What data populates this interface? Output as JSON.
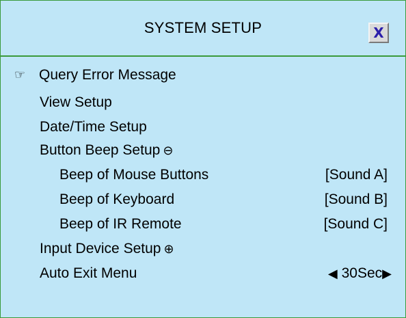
{
  "window": {
    "title": "SYSTEM SETUP",
    "close_label": "X"
  },
  "menu": {
    "items": [
      {
        "label": "Query Error Message"
      },
      {
        "label": "View Setup"
      },
      {
        "label": "Date/Time Setup"
      },
      {
        "label": "Button Beep Setup",
        "symbol": "⊖"
      },
      {
        "label": "Beep of  Mouse Buttons",
        "value": "[Sound A]"
      },
      {
        "label": "Beep of  Keyboard",
        "value": "[Sound B]"
      },
      {
        "label": "Beep of  IR Remote",
        "value": "[Sound C]"
      },
      {
        "label": "Input Device Setup",
        "symbol": "⊕"
      },
      {
        "label": "Auto Exit Menu",
        "value": "30Sec"
      }
    ],
    "pointer_glyph": "☞",
    "arrow_left": "◀",
    "arrow_right": "▶"
  },
  "colors": {
    "background": "#bfe6f7",
    "border": "#3a9a3a",
    "close_x": "#2b1eaa"
  },
  "icons": {
    "close": "close-icon",
    "pointer": "pointing-hand-icon",
    "collapse": "minus-circle-icon",
    "expand": "plus-circle-icon",
    "left": "left-arrow-icon",
    "right": "right-arrow-icon"
  }
}
